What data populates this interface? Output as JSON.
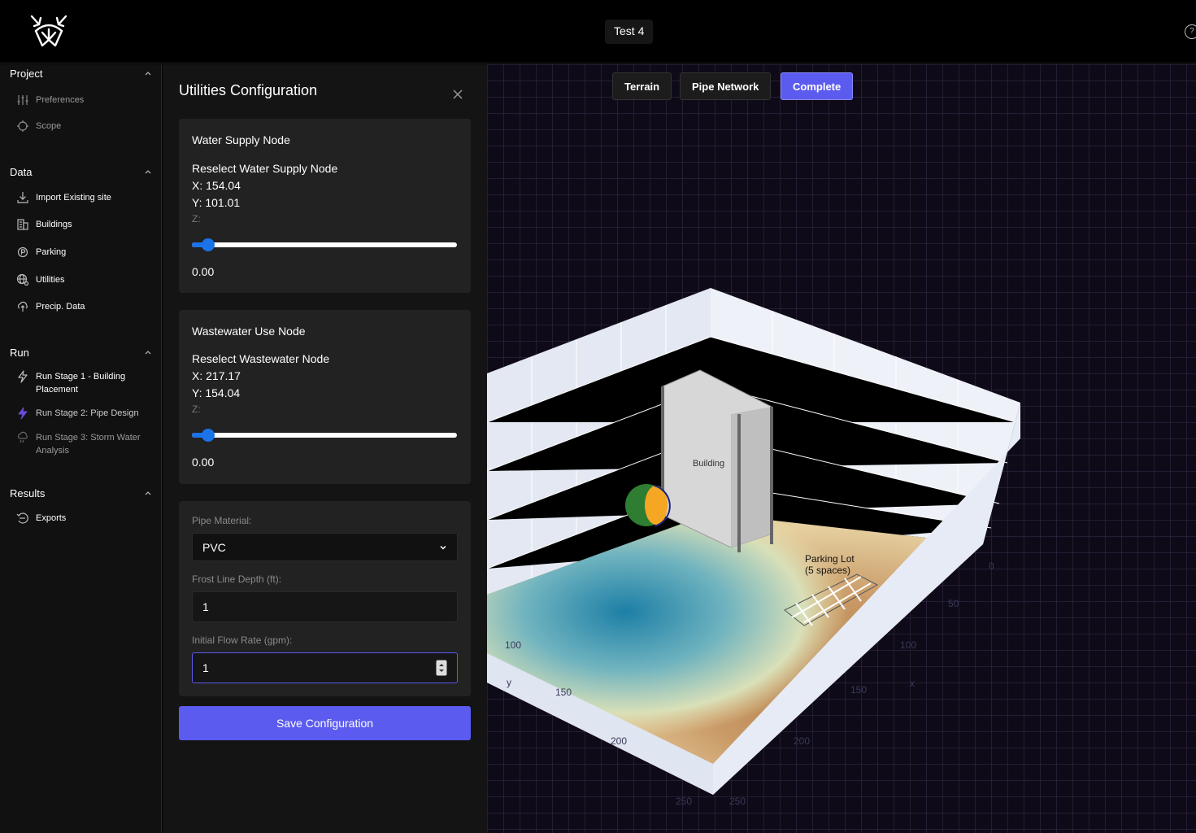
{
  "header": {
    "project_title": "Test 4"
  },
  "sidebar": {
    "sections": [
      {
        "title": "Project",
        "items": [
          {
            "label": "Preferences",
            "icon": "sliders-icon"
          },
          {
            "label": "Scope",
            "icon": "crosshair-icon"
          }
        ]
      },
      {
        "title": "Data",
        "items": [
          {
            "label": "Import Existing site",
            "icon": "download-icon"
          },
          {
            "label": "Buildings",
            "icon": "building-icon"
          },
          {
            "label": "Parking",
            "icon": "parking-icon"
          },
          {
            "label": "Utilities",
            "icon": "globe-icon"
          },
          {
            "label": "Precip. Data",
            "icon": "cloud-upload-icon"
          }
        ]
      },
      {
        "title": "Run",
        "items": [
          {
            "label": "Run Stage 1 - Building Placement",
            "icon": "lightning-icon"
          },
          {
            "label": "Run Stage 2: Pipe Design",
            "icon": "lightning-icon"
          },
          {
            "label": "Run Stage 3: Storm Water Analysis",
            "icon": "cloud-rain-icon"
          }
        ]
      },
      {
        "title": "Results",
        "items": [
          {
            "label": "Exports",
            "icon": "export-icon"
          }
        ]
      }
    ]
  },
  "panel": {
    "title": "Utilities Configuration",
    "water": {
      "title": "Water Supply Node",
      "reselect": "Reselect Water Supply Node",
      "x": "X: 154.04",
      "y": "Y: 101.01",
      "z_label": "Z:",
      "z_value": "0.00",
      "slider_fraction": 0.06
    },
    "wastewater": {
      "title": "Wastewater Use Node",
      "reselect": "Reselect Wastewater Node",
      "x": "X: 217.17",
      "y": "Y: 154.04",
      "z_label": "Z:",
      "z_value": "0.00",
      "slider_fraction": 0.06
    },
    "pipe_material_label": "Pipe Material:",
    "pipe_material_value": "PVC",
    "frost_label": "Frost Line Depth (ft):",
    "frost_value": "1",
    "flow_label": "Initial Flow Rate (gpm):",
    "flow_value": "1",
    "save_label": "Save Configuration"
  },
  "viewport": {
    "buttons": [
      "Terrain",
      "Pipe Network",
      "Complete"
    ],
    "active_button": "Complete",
    "building_label": "Building",
    "parking_label_line1": "Parking Lot",
    "parking_label_line2": "(5 spaces)",
    "x_axis_title": "x",
    "y_axis_title": "y",
    "x_ticks": [
      "0",
      "50",
      "100",
      "150",
      "200",
      "250"
    ],
    "y_ticks": [
      "100",
      "150",
      "200",
      "250"
    ]
  },
  "colors": {
    "accent": "#5b5bf0",
    "slider": "#1a73e8"
  }
}
